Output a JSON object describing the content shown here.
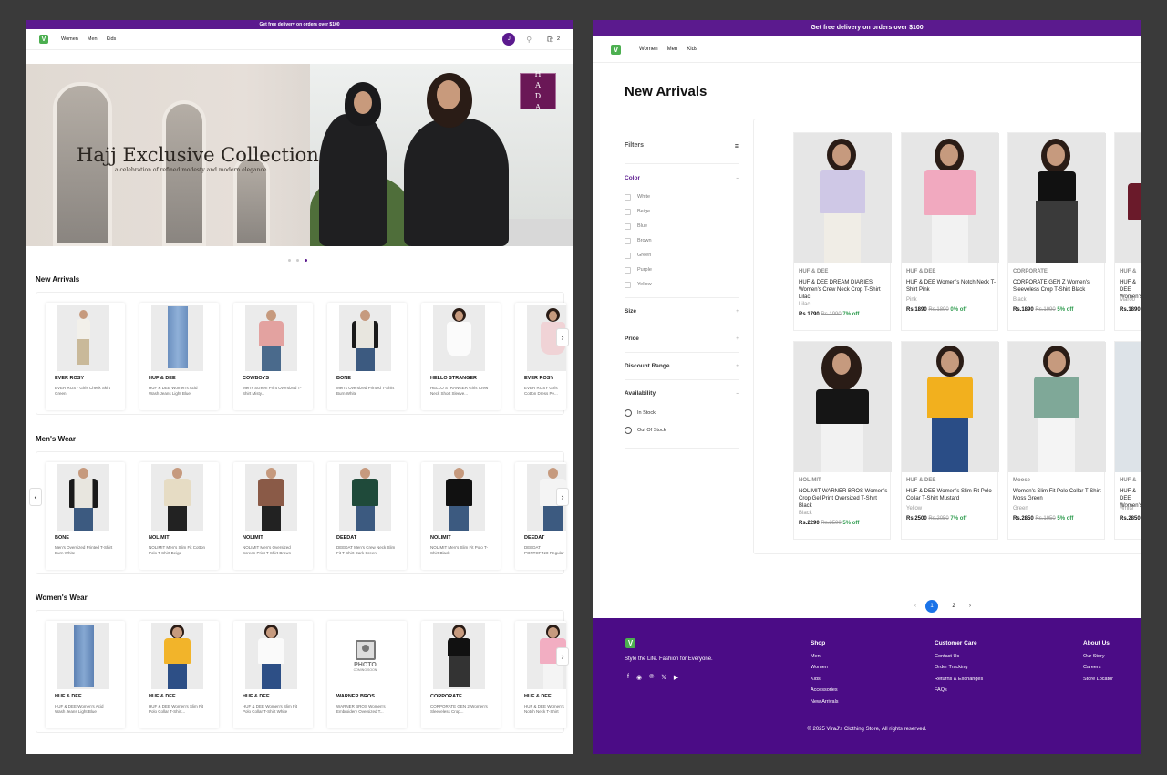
{
  "banner": "Get free delivery on orders over $100",
  "brand_logo_letter": "V",
  "nav": {
    "links": [
      "Women",
      "Men",
      "Kids"
    ],
    "avatar": "J",
    "cart_count": "2"
  },
  "hero": {
    "title": "Hajj Exclusive Collection",
    "subtitle": "a celebration of refined modesty and modern elegance",
    "badge": "HADA"
  },
  "sections": [
    {
      "title": "New Arrivals",
      "items": [
        {
          "brand": "EVER ROSY",
          "desc": "EVER ROSY Girls Check Skirt Green"
        },
        {
          "brand": "HUF & DEE",
          "desc": "HUF & DEE Women's Acid Wash Jeans Light Blue"
        },
        {
          "brand": "COWBOYS",
          "desc": "Men's Screen Print Oversized T-Shirt Misty..."
        },
        {
          "brand": "BONE",
          "desc": "Men's Oversized Printed T-Shirt Burn White"
        },
        {
          "brand": "HELLO STRANGER",
          "desc": "HELLO STRANGER Girls Crew Neck Short Sleeve..."
        },
        {
          "brand": "EVER ROSY",
          "desc": "EVER ROSY Girls Cotton Dress Pe..."
        }
      ]
    },
    {
      "title": "Men's Wear",
      "items": [
        {
          "brand": "BONE",
          "desc": "Men's Oversized Printed T-Shirt Burn White"
        },
        {
          "brand": "NOLIMIT",
          "desc": "NOLIMIT Men's Slim Fit Cotton Polo T-Shirt Beige"
        },
        {
          "brand": "NOLIMIT",
          "desc": "NOLIMIT Men's Oversized Screen Print T-Shirt Brown"
        },
        {
          "brand": "DEEDAT",
          "desc": "DEEDAT Men's Crew Neck Slim Fit T-Shirt Dark Green"
        },
        {
          "brand": "NOLIMIT",
          "desc": "NOLIMIT Men's Slim Fit Polo T-Shirt Black"
        },
        {
          "brand": "DEEDAT",
          "desc": "DEEDAT PORTOFINO Regular Fit T-Shi..."
        }
      ]
    },
    {
      "title": "Women's Wear",
      "items": [
        {
          "brand": "HUF & DEE",
          "desc": "HUF & DEE Women's Acid Wash Jeans Light Blue"
        },
        {
          "brand": "HUF & DEE",
          "desc": "HUF & DEE Women's Slim Fit Polo Collar T-Shirt..."
        },
        {
          "brand": "HUF & DEE",
          "desc": "HUF & DEE Women's Slim Fit Polo Collar T-Shirt White"
        },
        {
          "brand": "WARNER BROS",
          "desc": "WARNER BROS Women's Embroidery Oversized T..."
        },
        {
          "brand": "CORPORATE",
          "desc": "CORPORATE GEN 2 Women's Sleeveless Crop..."
        },
        {
          "brand": "HUF & DEE",
          "desc": "HUF & DEE Women's Notch Neck T-Shirt Pink"
        }
      ]
    }
  ],
  "placeholder": {
    "text": "PHOTO",
    "sub": "COMING SOON"
  },
  "listing": {
    "title": "New Arrivals",
    "filters_label": "Filters",
    "color_label": "Color",
    "colors": [
      "White",
      "Beige",
      "Blue",
      "Brown",
      "Green",
      "Purple",
      "Yellow"
    ],
    "size_label": "Size",
    "price_label": "Price",
    "discount_label": "Discount Range",
    "availability_label": "Availability",
    "availability": [
      "In Stock",
      "Out Of Stock"
    ],
    "products": [
      {
        "brand": "HUF & DEE",
        "title": "HUF & DEE DREAM DIARIES Women's Crew Neck Crop T-Shirt Lilac",
        "color": "Lilac",
        "price": "Rs.1790",
        "old": "Rs.1990",
        "off": "7% off"
      },
      {
        "brand": "HUF & DEE",
        "title": "HUF & DEE Women's Notch Neck T-Shirt Pink",
        "color": "Pink",
        "price": "Rs.1890",
        "old": "Rs.1890",
        "off": "0% off"
      },
      {
        "brand": "CORPORATE",
        "title": "CORPORATE GEN Z Women's Sleeveless Crop T-Shirt Black",
        "color": "Black",
        "price": "Rs.1890",
        "old": "Rs.1990",
        "off": "5% off"
      },
      {
        "brand": "HUF &",
        "title": "HUF & DEE Women's Crop T-",
        "color": "Maroo",
        "price": "Rs.1890",
        "old": "",
        "off": ""
      },
      {
        "brand": "NOLIMIT",
        "title": "NOLIMIT WARNER BROS Women's Crop Gel Print Oversized T-Shirt Black",
        "color": "Black",
        "price": "Rs.2290",
        "old": "Rs.2500",
        "off": "5% off"
      },
      {
        "brand": "HUF & DEE",
        "title": "HUF & DEE Women's Slim Fit Polo Collar T-Shirt Mustard",
        "color": "Yellow",
        "price": "Rs.2500",
        "old": "Rs.2050",
        "off": "7% off"
      },
      {
        "brand": "Moose",
        "title": "Women's Slim Fit Polo Collar T-Shirt Moss Green",
        "color": "Green",
        "price": "Rs.2850",
        "old": "Rs.1950",
        "off": "5% off"
      },
      {
        "brand": "HUF &",
        "title": "HUF & DEE Women's Polo Co",
        "color": "White",
        "price": "Rs.2850",
        "old": "",
        "off": ""
      }
    ],
    "pages": [
      "1",
      "2"
    ]
  },
  "footer": {
    "tagline": "Style the Life. Fashion for Everyone.",
    "shop_title": "Shop",
    "shop": [
      "Men",
      "Women",
      "Kids",
      "Accessories",
      "New Arrivals"
    ],
    "care_title": "Customer Care",
    "care": [
      "Contact Us",
      "Order Tracking",
      "Returns & Exchanges",
      "FAQs"
    ],
    "about_title": "About Us",
    "about": [
      "Our Story",
      "Careers",
      "Store Locator"
    ],
    "copyright": "© 2025 ViraJ's Clothing Store, All rights reserved."
  },
  "colors": {
    "brand_purple": "#5b1a8e",
    "footer_purple": "#4b0c86",
    "logo_green": "#4caf50",
    "discount_green": "#2e9b4e",
    "pager_blue": "#1a73e8"
  }
}
